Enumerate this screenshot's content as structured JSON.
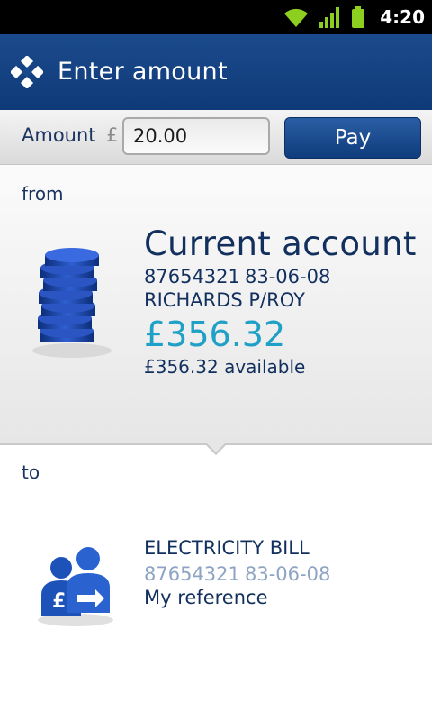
{
  "status_bar": {
    "time": "4:20"
  },
  "header": {
    "title": "Enter amount"
  },
  "amount_bar": {
    "label": "Amount",
    "currency_symbol": "£",
    "amount_value": "20.00",
    "pay_label": "Pay"
  },
  "from": {
    "label": "from",
    "account_name": "Current account",
    "account_number": "87654321",
    "sort_code": "83-06-08",
    "holder": "RICHARDS P/ROY",
    "balance": "£356.32",
    "available": "£356.32 available"
  },
  "to": {
    "label": "to",
    "payee_name": "ELECTRICITY BILL",
    "account_number": "87654321",
    "sort_code": "83-06-08",
    "reference": "My reference"
  },
  "icons": {
    "wifi": "wifi-icon",
    "signal": "signal-icon",
    "battery": "battery-icon",
    "logo": "bank-logo",
    "coins": "coins-icon",
    "payee": "payee-icon"
  },
  "colors": {
    "header": "#1b4a8c",
    "pay_button": "#1a4a8e",
    "balance": "#1fa0c6",
    "text_primary": "#12305e",
    "text_muted": "#8ea4c4"
  }
}
